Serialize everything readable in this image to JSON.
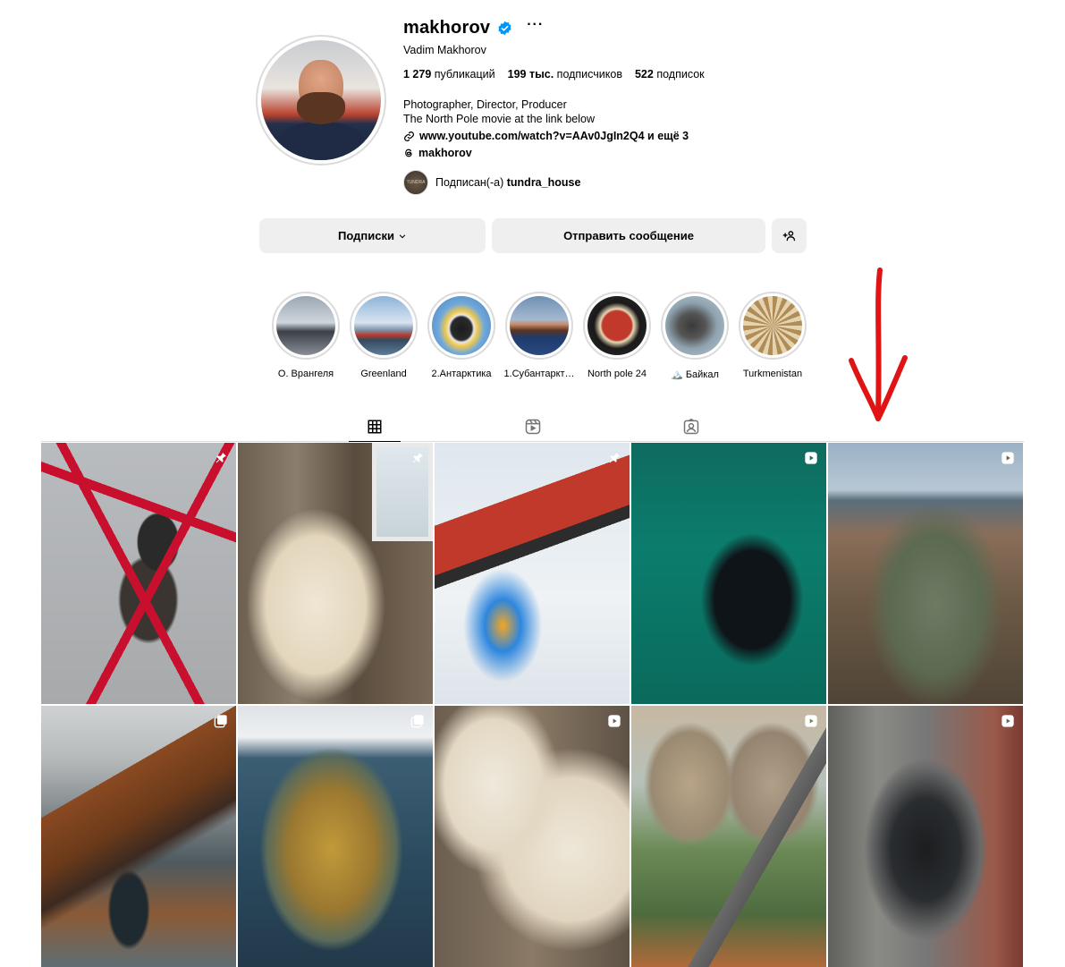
{
  "profile": {
    "username": "makhorov",
    "full_name": "Vadim Makhorov",
    "stats": {
      "posts_count": "1 279",
      "posts_label": "публикаций",
      "followers_count": "199 тыс.",
      "followers_label": "подписчиков",
      "following_count": "522",
      "following_label": "подписок"
    },
    "bio_line1": "Photographer, Director, Producer",
    "bio_line2": "The North Pole movie at the link below",
    "link_text": "www.youtube.com/watch?v=AAv0JgIn2Q4 и ещё 3",
    "threads_handle": "makhorov",
    "followed_by_prefix": "Подписан(-а)",
    "followed_by_user": "tundra_house",
    "followed_avatar_text": "TUNDRA"
  },
  "actions": {
    "following_label": "Подписки",
    "message_label": "Отправить сообщение"
  },
  "highlights": [
    {
      "label": "О. Врангеля"
    },
    {
      "label": "Greenland"
    },
    {
      "label": "2.Антарктика"
    },
    {
      "label": "1.Субантаркт…"
    },
    {
      "label": "North pole 24"
    },
    {
      "label": "🏔️ Байкал"
    },
    {
      "label": "Turkmenistan"
    }
  ],
  "tabs": [
    {
      "name": "posts-grid-icon",
      "active": true
    },
    {
      "name": "reels-icon",
      "active": false
    },
    {
      "name": "tagged-icon",
      "active": false
    }
  ],
  "posts": [
    {
      "subject": "climber on red tower",
      "badge": "pin-icon"
    },
    {
      "subject": "polar bear in abandoned house",
      "badge": "pin-icon"
    },
    {
      "subject": "nuclear icebreaker and helicopter",
      "badge": "pin-icon"
    },
    {
      "subject": "orca in green water",
      "badge": "reel-icon"
    },
    {
      "subject": "abandoned plane wreck in tundra",
      "badge": "reel-icon"
    },
    {
      "subject": "mountains and lagoon aerial",
      "badge": "carousel-icon"
    },
    {
      "subject": "island aerial in sea",
      "badge": "carousel-icon"
    },
    {
      "subject": "polar bears behind window frame",
      "badge": "reel-icon"
    },
    {
      "subject": "cooling towers and train",
      "badge": "reel-icon"
    },
    {
      "subject": "tunnel inside ruins",
      "badge": "reel-icon"
    }
  ],
  "colors": {
    "annotation_arrow": "#e01414",
    "verified": "#0095f6",
    "button_bg": "#efefef"
  }
}
